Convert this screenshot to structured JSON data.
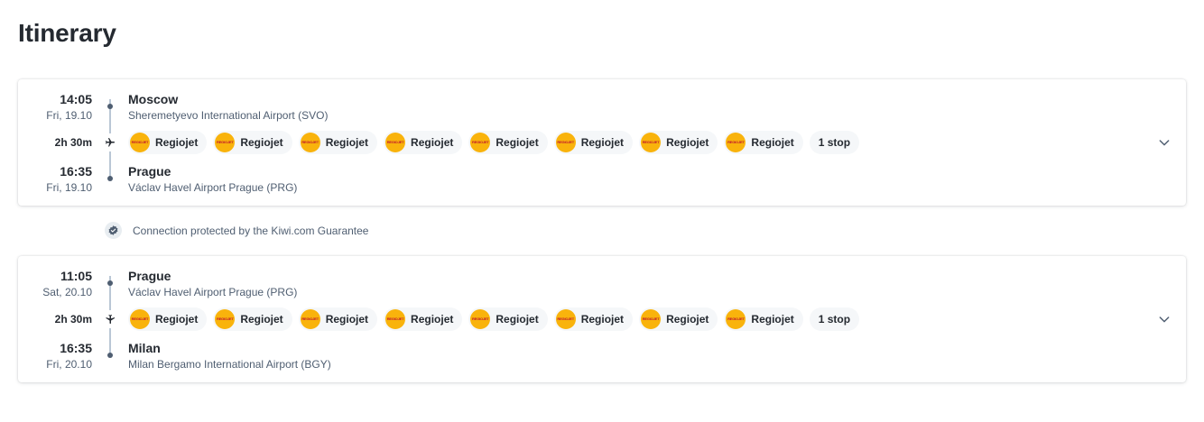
{
  "page": {
    "title": "Itinerary"
  },
  "colors": {
    "text": "#252a31",
    "secondary": "#4f5e71",
    "carrier_logo": "#f9b30c",
    "chip_bg": "#f5f7f9"
  },
  "segments": [
    {
      "departure": {
        "time": "14:05",
        "date": "Fri, 19.10",
        "city": "Moscow",
        "station": "Sheremetyevo International Airport (SVO)"
      },
      "duration": "2h 30m",
      "mode_icon": "airplane-icon",
      "carriers": [
        "Regiojet",
        "Regiojet",
        "Regiojet",
        "Regiojet",
        "Regiojet",
        "Regiojet",
        "Regiojet",
        "Regiojet"
      ],
      "stops": "1 stop",
      "arrival": {
        "time": "16:35",
        "date": "Fri, 19.10",
        "city": "Prague",
        "station": "Václav Havel Airport Prague (PRG)"
      }
    },
    {
      "departure": {
        "time": "11:05",
        "date": "Sat, 20.10",
        "city": "Prague",
        "station": "Václav Havel Airport Prague (PRG)"
      },
      "duration": "2h 30m",
      "mode_icon": "airplane-icon",
      "carriers": [
        "Regiojet",
        "Regiojet",
        "Regiojet",
        "Regiojet",
        "Regiojet",
        "Regiojet",
        "Regiojet",
        "Regiojet"
      ],
      "stops": "1 stop",
      "arrival": {
        "time": "16:35",
        "date": "Fri, 20.10",
        "city": "Milan",
        "station": "Milan Bergamo International Airport (BGY)"
      }
    }
  ],
  "guarantee": {
    "text": "Connection protected by the Kiwi.com Guarantee",
    "icon": "shield-check-icon"
  }
}
